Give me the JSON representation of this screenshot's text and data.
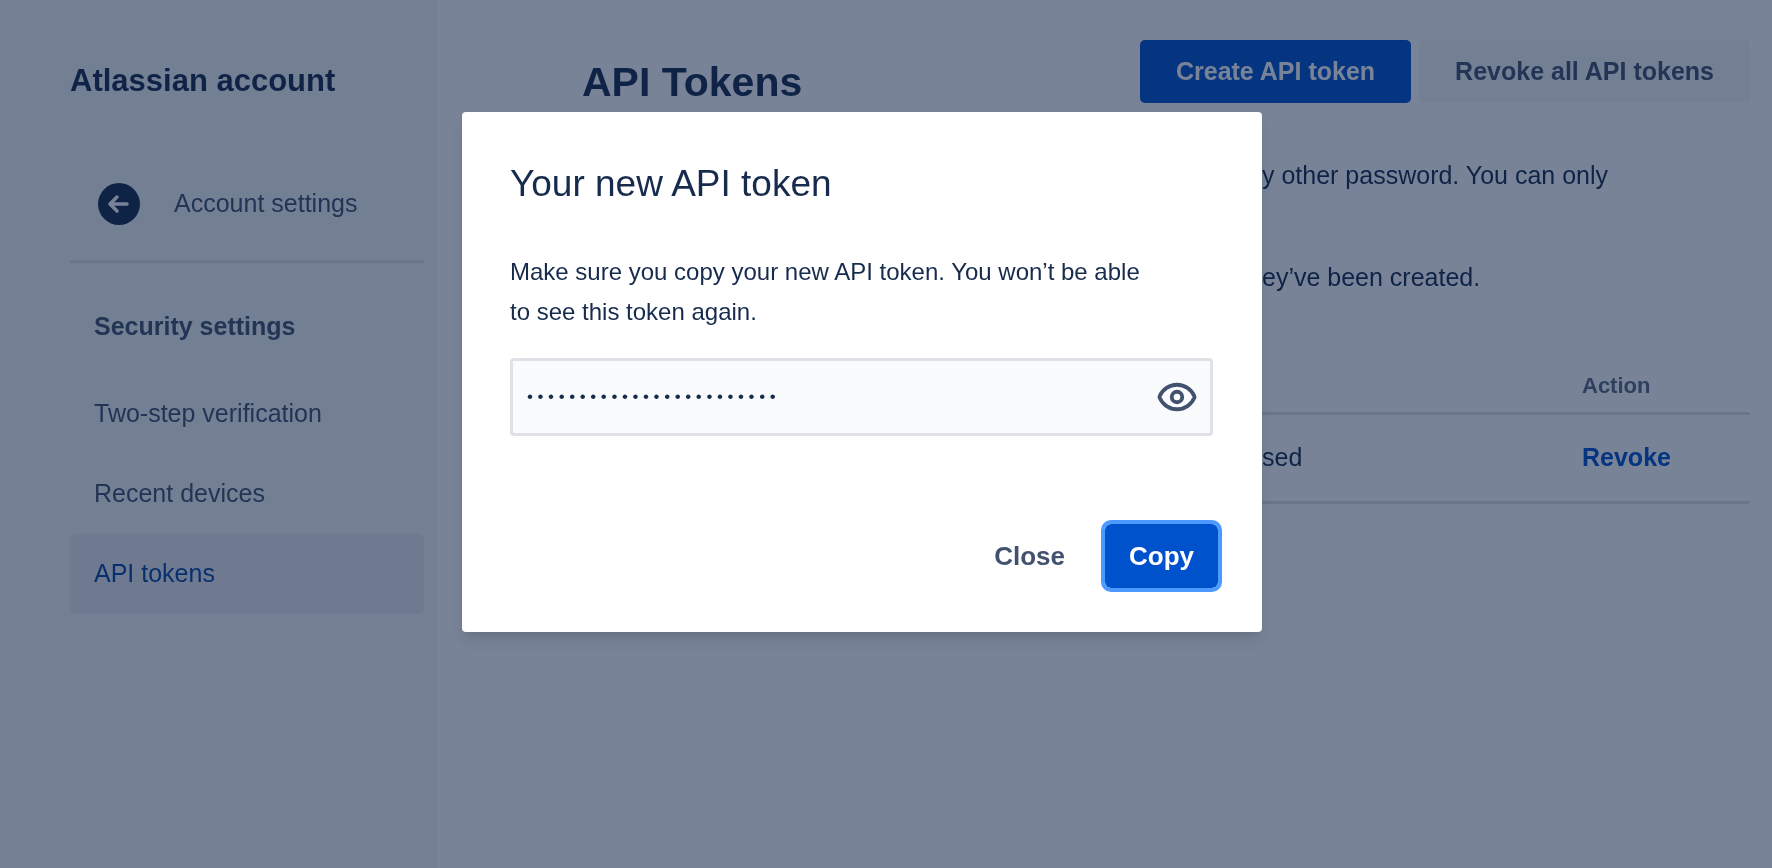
{
  "sidebar": {
    "title": "Atlassian account",
    "back_link": "Account settings",
    "section_heading": "Security settings",
    "items": [
      {
        "label": "Two-step verification",
        "selected": false
      },
      {
        "label": "Recent devices",
        "selected": false
      },
      {
        "label": "API tokens",
        "selected": true
      }
    ]
  },
  "page": {
    "title": "API Tokens",
    "buttons": [
      {
        "label": "Create API token",
        "kind": "primary"
      },
      {
        "label": "Revoke all API tokens",
        "kind": "secondary"
      }
    ],
    "intro_lines": [
      "y other password. You can only",
      "ey’ve been created."
    ],
    "table": {
      "action_header": "Action",
      "rows": [
        {
          "cell": "sed",
          "action": "Revoke"
        }
      ]
    }
  },
  "dialog": {
    "title": "Your new API token",
    "message": "Make sure you copy your new API token. You won’t be able to see this token again.",
    "token_field": {
      "value": "••••••••••••••••••••••••"
    },
    "buttons": [
      {
        "label": "Close",
        "kind": "subtle"
      },
      {
        "label": "Copy",
        "kind": "primary"
      }
    ]
  }
}
